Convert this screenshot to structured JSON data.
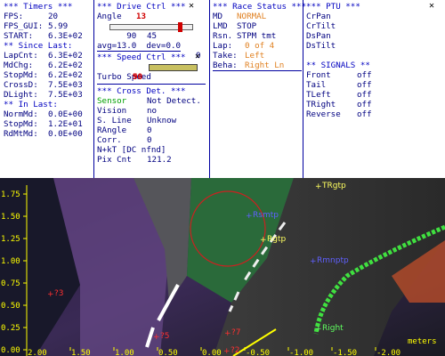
{
  "timers": {
    "title": "*** Timers ***",
    "rows": [
      {
        "label": "FPS:",
        "value": "20"
      },
      {
        "label": "FPS_GUI:",
        "value": "5.99"
      },
      {
        "label": "START:",
        "value": "6.3E+02"
      }
    ],
    "since_title": "** Since Last:",
    "since_rows": [
      {
        "label": "LapCnt:",
        "value": "6.3E+02"
      },
      {
        "label": "MdChg:",
        "value": "6.2E+02"
      },
      {
        "label": "StopMd:",
        "value": "6.2E+02"
      },
      {
        "label": "CrossD:",
        "value": "7.5E+03"
      },
      {
        "label": "DLight:",
        "value": "7.5E+03"
      }
    ],
    "in_title": "** In Last:",
    "in_rows": [
      {
        "label": "NormMd:",
        "value": "0.0E+00"
      },
      {
        "label": "StopMd:",
        "value": "1.2E+01"
      },
      {
        "label": "RdMtMd:",
        "value": "0.0E+00"
      }
    ]
  },
  "drive": {
    "title": "*** Drive Ctrl ***",
    "angle_label": "Angle",
    "angle_value": "13",
    "slider_min": "90",
    "slider_max": "0",
    "slider_level": 0.87,
    "slider_mid": "45",
    "avg_line": "avg=13.0  dev=0.0",
    "speed_title": "*** Speed Ctrl ***",
    "speed_label": "Speed",
    "speed_value": "90",
    "speed_level": 1.0,
    "turbo_label": "Turbo",
    "turbo_value": "50",
    "cross_title": "*** Cross Det. ***",
    "cross_rows": [
      {
        "label": "Sensor",
        "value": "Not Detect."
      },
      {
        "label": "Vision",
        "value": "no"
      },
      {
        "label": "S. Line",
        "value": "Unknow"
      },
      {
        "label": "RAngle",
        "value": "0"
      },
      {
        "label": "Corr.",
        "value": "0"
      }
    ],
    "nkt": "N+kT [DC nfnd]",
    "pix_label": "Pix Cnt",
    "pix_value": "121.2"
  },
  "race": {
    "title": "*** Race Status ***",
    "md_label": "MD",
    "md_value": "NORMAL",
    "lmd_label": "LMD",
    "lmd_value": "STOP",
    "rsn_label": "Rsn.",
    "rsn_value": "STPM tmt",
    "lap_label": "Lap:",
    "lap_value": "0 of 4",
    "take_label": "Take:",
    "take_value": "Left",
    "beha_label": "Beha:",
    "beha_value": "Right Ln"
  },
  "ptu": {
    "title": "*** PTU ***",
    "items": [
      "CrPan",
      "CrTilt",
      "DsPan",
      "DsTilt"
    ],
    "signals_title": "** SIGNALS **",
    "signals": [
      {
        "label": "Front",
        "value": "off"
      },
      {
        "label": "Tail",
        "value": "off"
      },
      {
        "label": "TLeft",
        "value": "off"
      },
      {
        "label": "TRight",
        "value": "off"
      },
      {
        "label": "Reverse",
        "value": "off"
      }
    ]
  },
  "camera": {
    "y_ticks": [
      "1.75",
      "1.50",
      "1.25",
      "1.00",
      "0.75",
      "0.50",
      "0.25",
      "0.00"
    ],
    "x_ticks": [
      "2.00",
      "1.50",
      "1.00",
      "0.50",
      "0.00",
      "-0.50",
      "-1.00",
      "-1.50",
      "-2.00"
    ],
    "x_unit": "meters",
    "markers": [
      {
        "label": "TRgtp",
        "color": "#ffff60"
      },
      {
        "label": "Rsmtp",
        "color": "#6060ff"
      },
      {
        "label": "Rgtp",
        "color": "#ffff60"
      },
      {
        "label": "Rmnptp",
        "color": "#6060ff"
      },
      {
        "label": "Right",
        "color": "#60ff60"
      },
      {
        "label": "?3",
        "color": "#ff3030"
      },
      {
        "label": "?5",
        "color": "#ff3030"
      },
      {
        "label": "?7",
        "color": "#ff3030"
      },
      {
        "label": "?2",
        "color": "#ff3030"
      }
    ],
    "colors": {
      "lane": "#40e040",
      "circle": "#cc2020",
      "axis": "#ffff00"
    }
  }
}
